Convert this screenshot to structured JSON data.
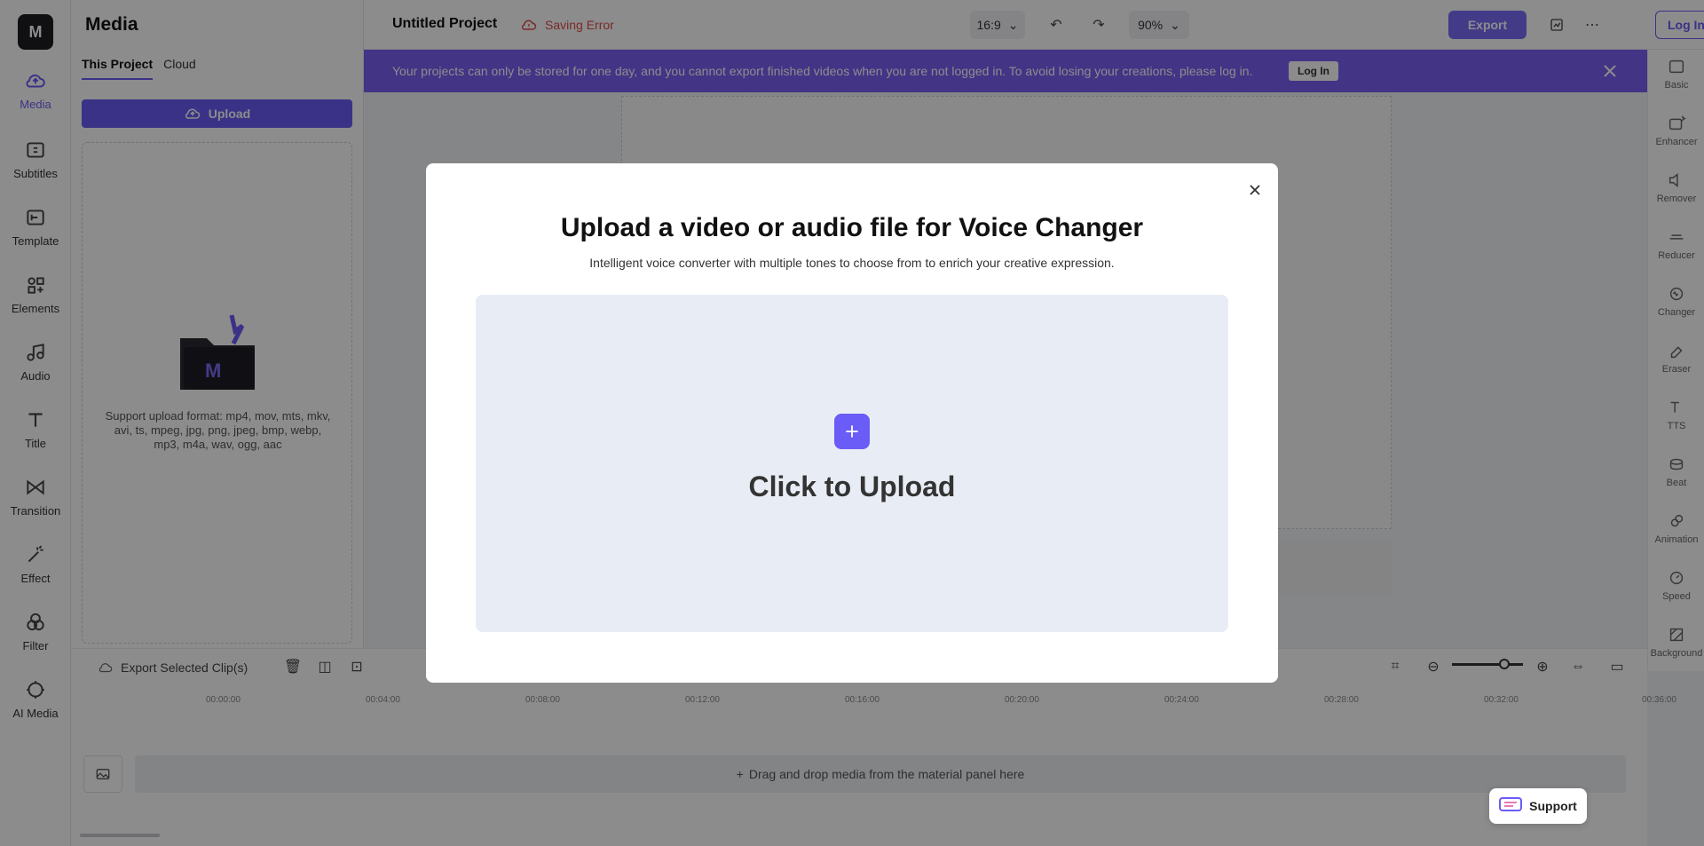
{
  "app": {
    "logo_text": "M"
  },
  "rail": {
    "items": [
      {
        "label": "Media",
        "icon": "cloud-upload-icon"
      },
      {
        "label": "Subtitles",
        "icon": "subtitles-icon"
      },
      {
        "label": "Template",
        "icon": "template-icon"
      },
      {
        "label": "Elements",
        "icon": "elements-icon"
      },
      {
        "label": "Audio",
        "icon": "music-note-icon"
      },
      {
        "label": "Title",
        "icon": "text-icon"
      },
      {
        "label": "Transition",
        "icon": "transition-icon"
      },
      {
        "label": "Effect",
        "icon": "magic-wand-icon"
      },
      {
        "label": "Filter",
        "icon": "filter-icon"
      },
      {
        "label": "AI Media",
        "icon": "ai-icon"
      }
    ]
  },
  "media_panel": {
    "title": "Media",
    "tabs": [
      "This Project",
      "Cloud"
    ],
    "upload_label": "Upload",
    "format_text": "Support upload format: mp4, mov, mts, mkv, avi, ts, mpeg, jpg, png, jpeg, bmp, webp, mp3, m4a, wav, ogg, aac"
  },
  "topbar": {
    "project_title": "Untitled Project",
    "saving_status": "Saving Error",
    "aspect_ratio": "16:9",
    "zoom": "90%",
    "export_label": "Export",
    "login_label": "Log In"
  },
  "banner": {
    "text": "Your projects can only be stored for one day, and you cannot export finished videos when you are not logged in. To avoid losing your creations, please log in.",
    "login_label": "Log In"
  },
  "right_rail": {
    "items": [
      "Basic",
      "Enhancer",
      "Remover",
      "Reducer",
      "Changer",
      "Eraser",
      "TTS",
      "Beat",
      "Animation",
      "Speed",
      "Background"
    ]
  },
  "timeline": {
    "export_clips_label": "Export Selected Clip(s)",
    "ticks": [
      "00:00:00",
      "00:04:00",
      "00:08:00",
      "00:12:00",
      "00:16:00",
      "00:20:00",
      "00:24:00",
      "00:28:00",
      "00:32:00",
      "00:36:00"
    ],
    "drop_hint": "Drag and drop media from the material panel here"
  },
  "support": {
    "label": "Support"
  },
  "modal": {
    "title": "Upload a video or audio file for Voice Changer",
    "subtitle": "Intelligent voice converter with multiple tones to choose from to enrich your creative expression.",
    "cta": "Click to Upload"
  },
  "colors": {
    "accent": "#6a5cf6",
    "banner": "#7a5ff5",
    "error": "#e14c4c"
  }
}
